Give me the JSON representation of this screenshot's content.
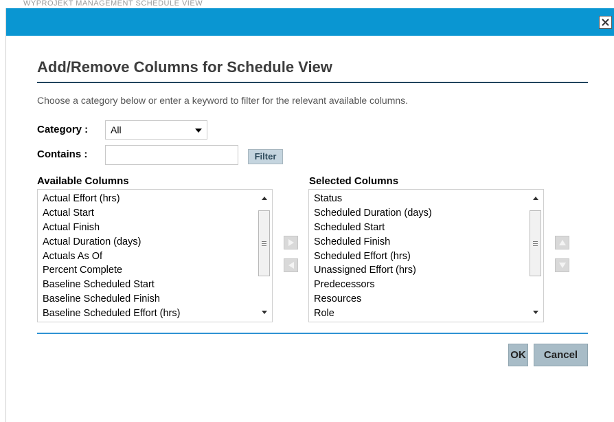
{
  "background": {
    "ghost_text": "WYPROJEKT MANAGEMENT SCHEDULE VIEW"
  },
  "dialog": {
    "title_bar_color": "#0a96d2",
    "close_label": "✕",
    "heading": "Add/Remove Columns for Schedule View",
    "instructions": "Choose a category below or enter a keyword to filter for the relevant available columns.",
    "category": {
      "label": "Category :",
      "selected": "All"
    },
    "contains": {
      "label": "Contains :",
      "value": "",
      "placeholder": ""
    },
    "filter_label": "Filter",
    "available": {
      "header": "Available Columns",
      "items": [
        "Actual Effort (hrs)",
        "Actual Start",
        "Actual Finish",
        "Actual Duration (days)",
        "Actuals As Of",
        "Percent Complete",
        "Baseline Scheduled Start",
        "Baseline Scheduled Finish",
        "Baseline Scheduled Effort (hrs)"
      ]
    },
    "selected": {
      "header": "Selected Columns",
      "items": [
        "Status",
        "Scheduled Duration (days)",
        "Scheduled Start",
        "Scheduled Finish",
        "Scheduled Effort (hrs)",
        "Unassigned Effort (hrs)",
        "Predecessors",
        "Resources",
        "Role"
      ]
    },
    "buttons": {
      "ok": "OK",
      "cancel": "Cancel"
    }
  }
}
